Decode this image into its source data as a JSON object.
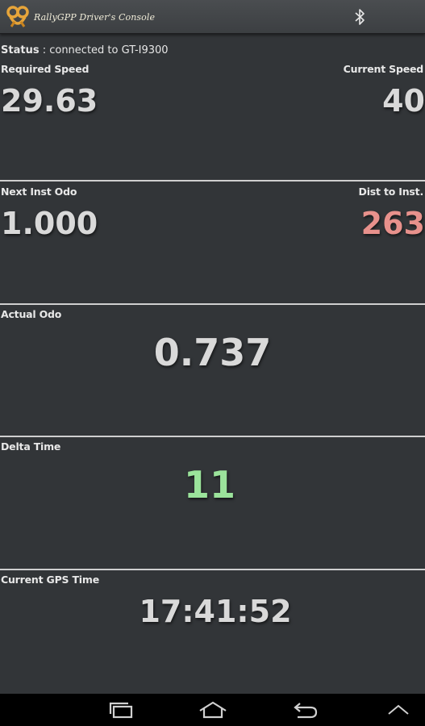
{
  "action_bar": {
    "title": "RallyGPP Driver's Console",
    "app_icon": "pretzel-logo-icon",
    "bluetooth_icon": "bluetooth-icon"
  },
  "status": {
    "label": "Status",
    "separator": " : ",
    "value": "connected to GT-I9300"
  },
  "panels": {
    "required_speed": {
      "label": "Required Speed",
      "value": "29.63"
    },
    "current_speed": {
      "label": "Current Speed",
      "value": "40"
    },
    "next_inst_odo": {
      "label": "Next Inst Odo",
      "value": "1.000"
    },
    "dist_to_inst": {
      "label": "Dist to Inst.",
      "value": "263"
    },
    "actual_odo": {
      "label": "Actual Odo",
      "value": "0.737"
    },
    "delta_time": {
      "label": "Delta Time",
      "value": "11"
    },
    "current_gps_time": {
      "label": "Current GPS Time",
      "value": "17:41:52"
    }
  },
  "colors": {
    "background": "#323538",
    "value_default": "#d9d9d9",
    "dist_to_inst": "#e8918c",
    "delta_time": "#9be39b",
    "divider": "#cfcfcf"
  },
  "nav_bar": {
    "recent_apps_icon": "recent-apps-icon",
    "home_icon": "home-icon",
    "back_icon": "back-icon",
    "menu_icon": "chevron-up-icon"
  }
}
